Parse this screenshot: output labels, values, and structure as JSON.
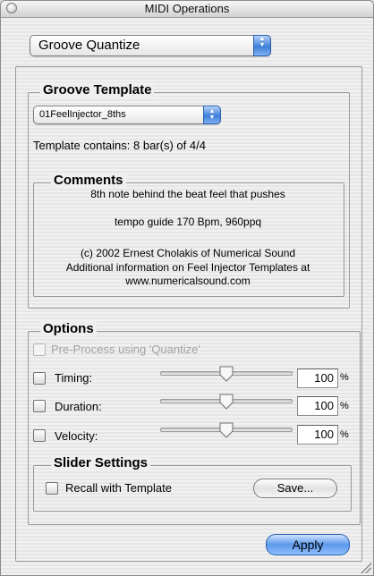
{
  "window": {
    "title": "MIDI Operations"
  },
  "operation_popup": {
    "selected": "Groove Quantize"
  },
  "groove_template": {
    "legend": "Groove Template",
    "template_popup": {
      "selected": "01FeelInjector_8ths"
    },
    "info": "Template contains: 8 bar(s) of 4/4",
    "comments": {
      "legend": "Comments",
      "lines": [
        "8th note behind the beat feel that pushes",
        "tempo guide 170 Bpm, 960ppq",
        "(c) 2002  Ernest Cholakis of Numerical Sound",
        "Additional information on Feel Injector Templates at",
        "www.numericalsound.com"
      ]
    }
  },
  "options": {
    "legend": "Options",
    "preprocess_label": "Pre-Process using 'Quantize'",
    "rows": [
      {
        "label": "Timing:",
        "value": "100",
        "unit": "%",
        "slider_fraction": 0.5
      },
      {
        "label": "Duration:",
        "value": "100",
        "unit": "%",
        "slider_fraction": 0.5
      },
      {
        "label": "Velocity:",
        "value": "100",
        "unit": "%",
        "slider_fraction": 0.5
      }
    ],
    "slider_settings": {
      "legend": "Slider Settings",
      "recall_label": "Recall with Template",
      "save_label": "Save..."
    }
  },
  "apply_label": "Apply",
  "colors": {
    "accent": "#3f7fd8",
    "window_bg": "#efefef"
  }
}
